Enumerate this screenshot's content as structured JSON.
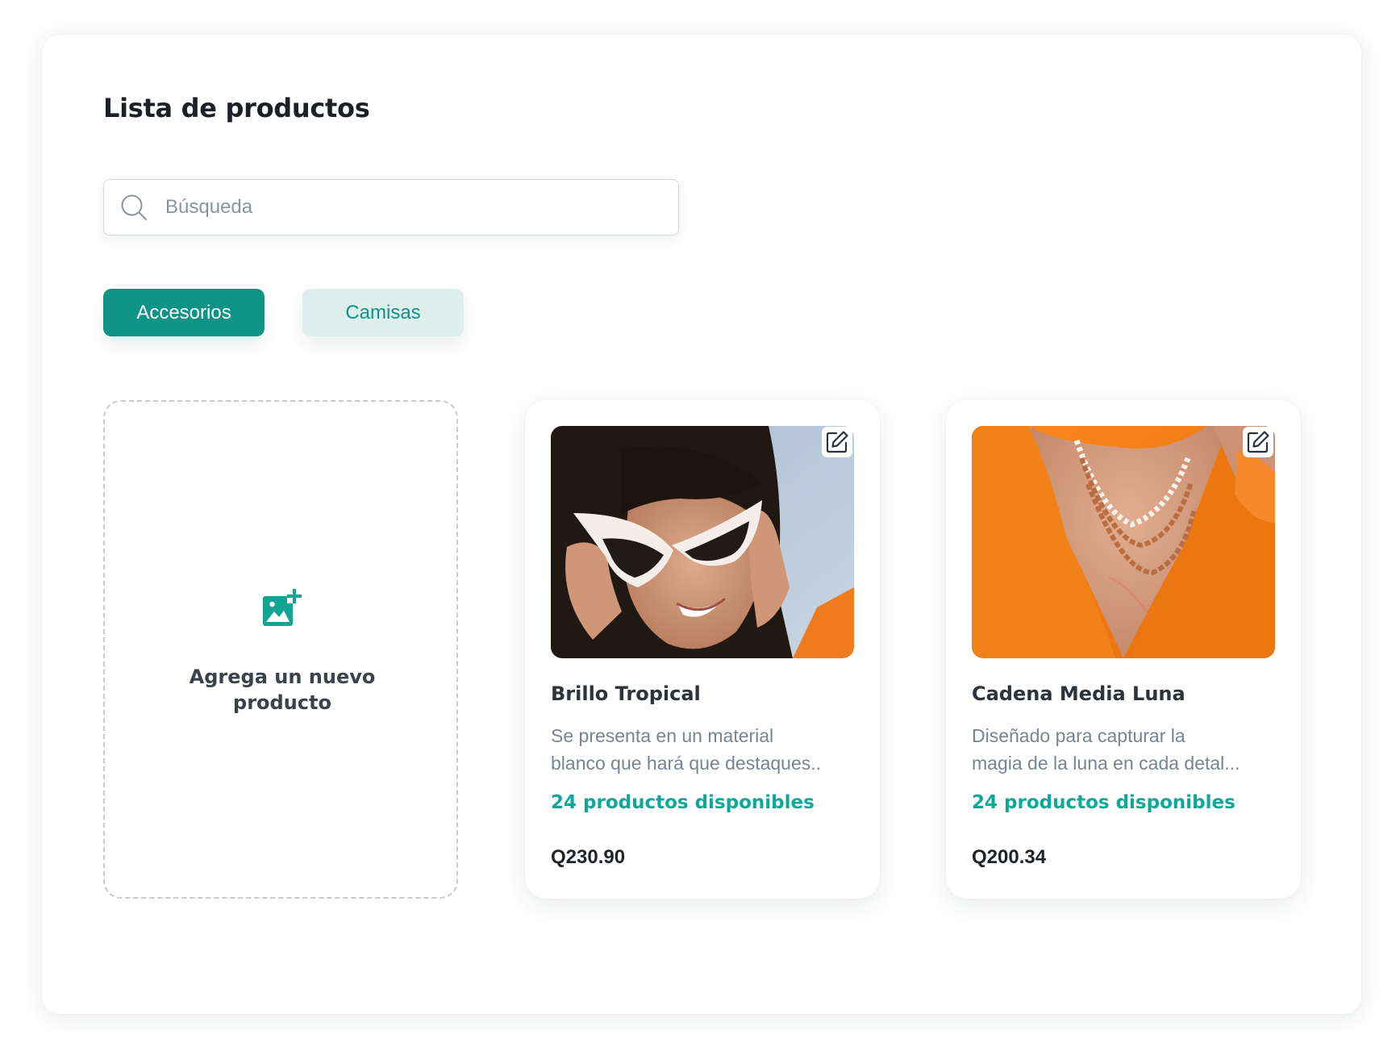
{
  "page": {
    "title": "Lista de productos"
  },
  "search": {
    "placeholder": "Búsqueda",
    "value": "",
    "icon": "search-icon"
  },
  "categories": [
    {
      "label": "Accesorios",
      "active": true
    },
    {
      "label": "Camisas",
      "active": false
    }
  ],
  "add_product": {
    "label": "Agrega un nuevo producto",
    "icon": "add-image-icon"
  },
  "products": [
    {
      "name": "Brillo Tropical",
      "description_lines": [
        "Se presenta en un material",
        "blanco que hará que destaques.."
      ],
      "stock": "24 productos disponibles",
      "price": "Q230.90",
      "image": "woman-white-sunglasses-photo"
    },
    {
      "name": "Cadena Media Luna",
      "description_lines": [
        "Diseñado para capturar la",
        "magia de la luna en cada detal..."
      ],
      "stock": "24 productos disponibles",
      "price": "Q200.34",
      "image": "gold-necklace-orange-shirt-photo"
    }
  ],
  "colors": {
    "accent": "#0f9387",
    "accent_light": "#dcefec",
    "stock_text": "#0ea89a",
    "title_text": "#1d2027"
  }
}
